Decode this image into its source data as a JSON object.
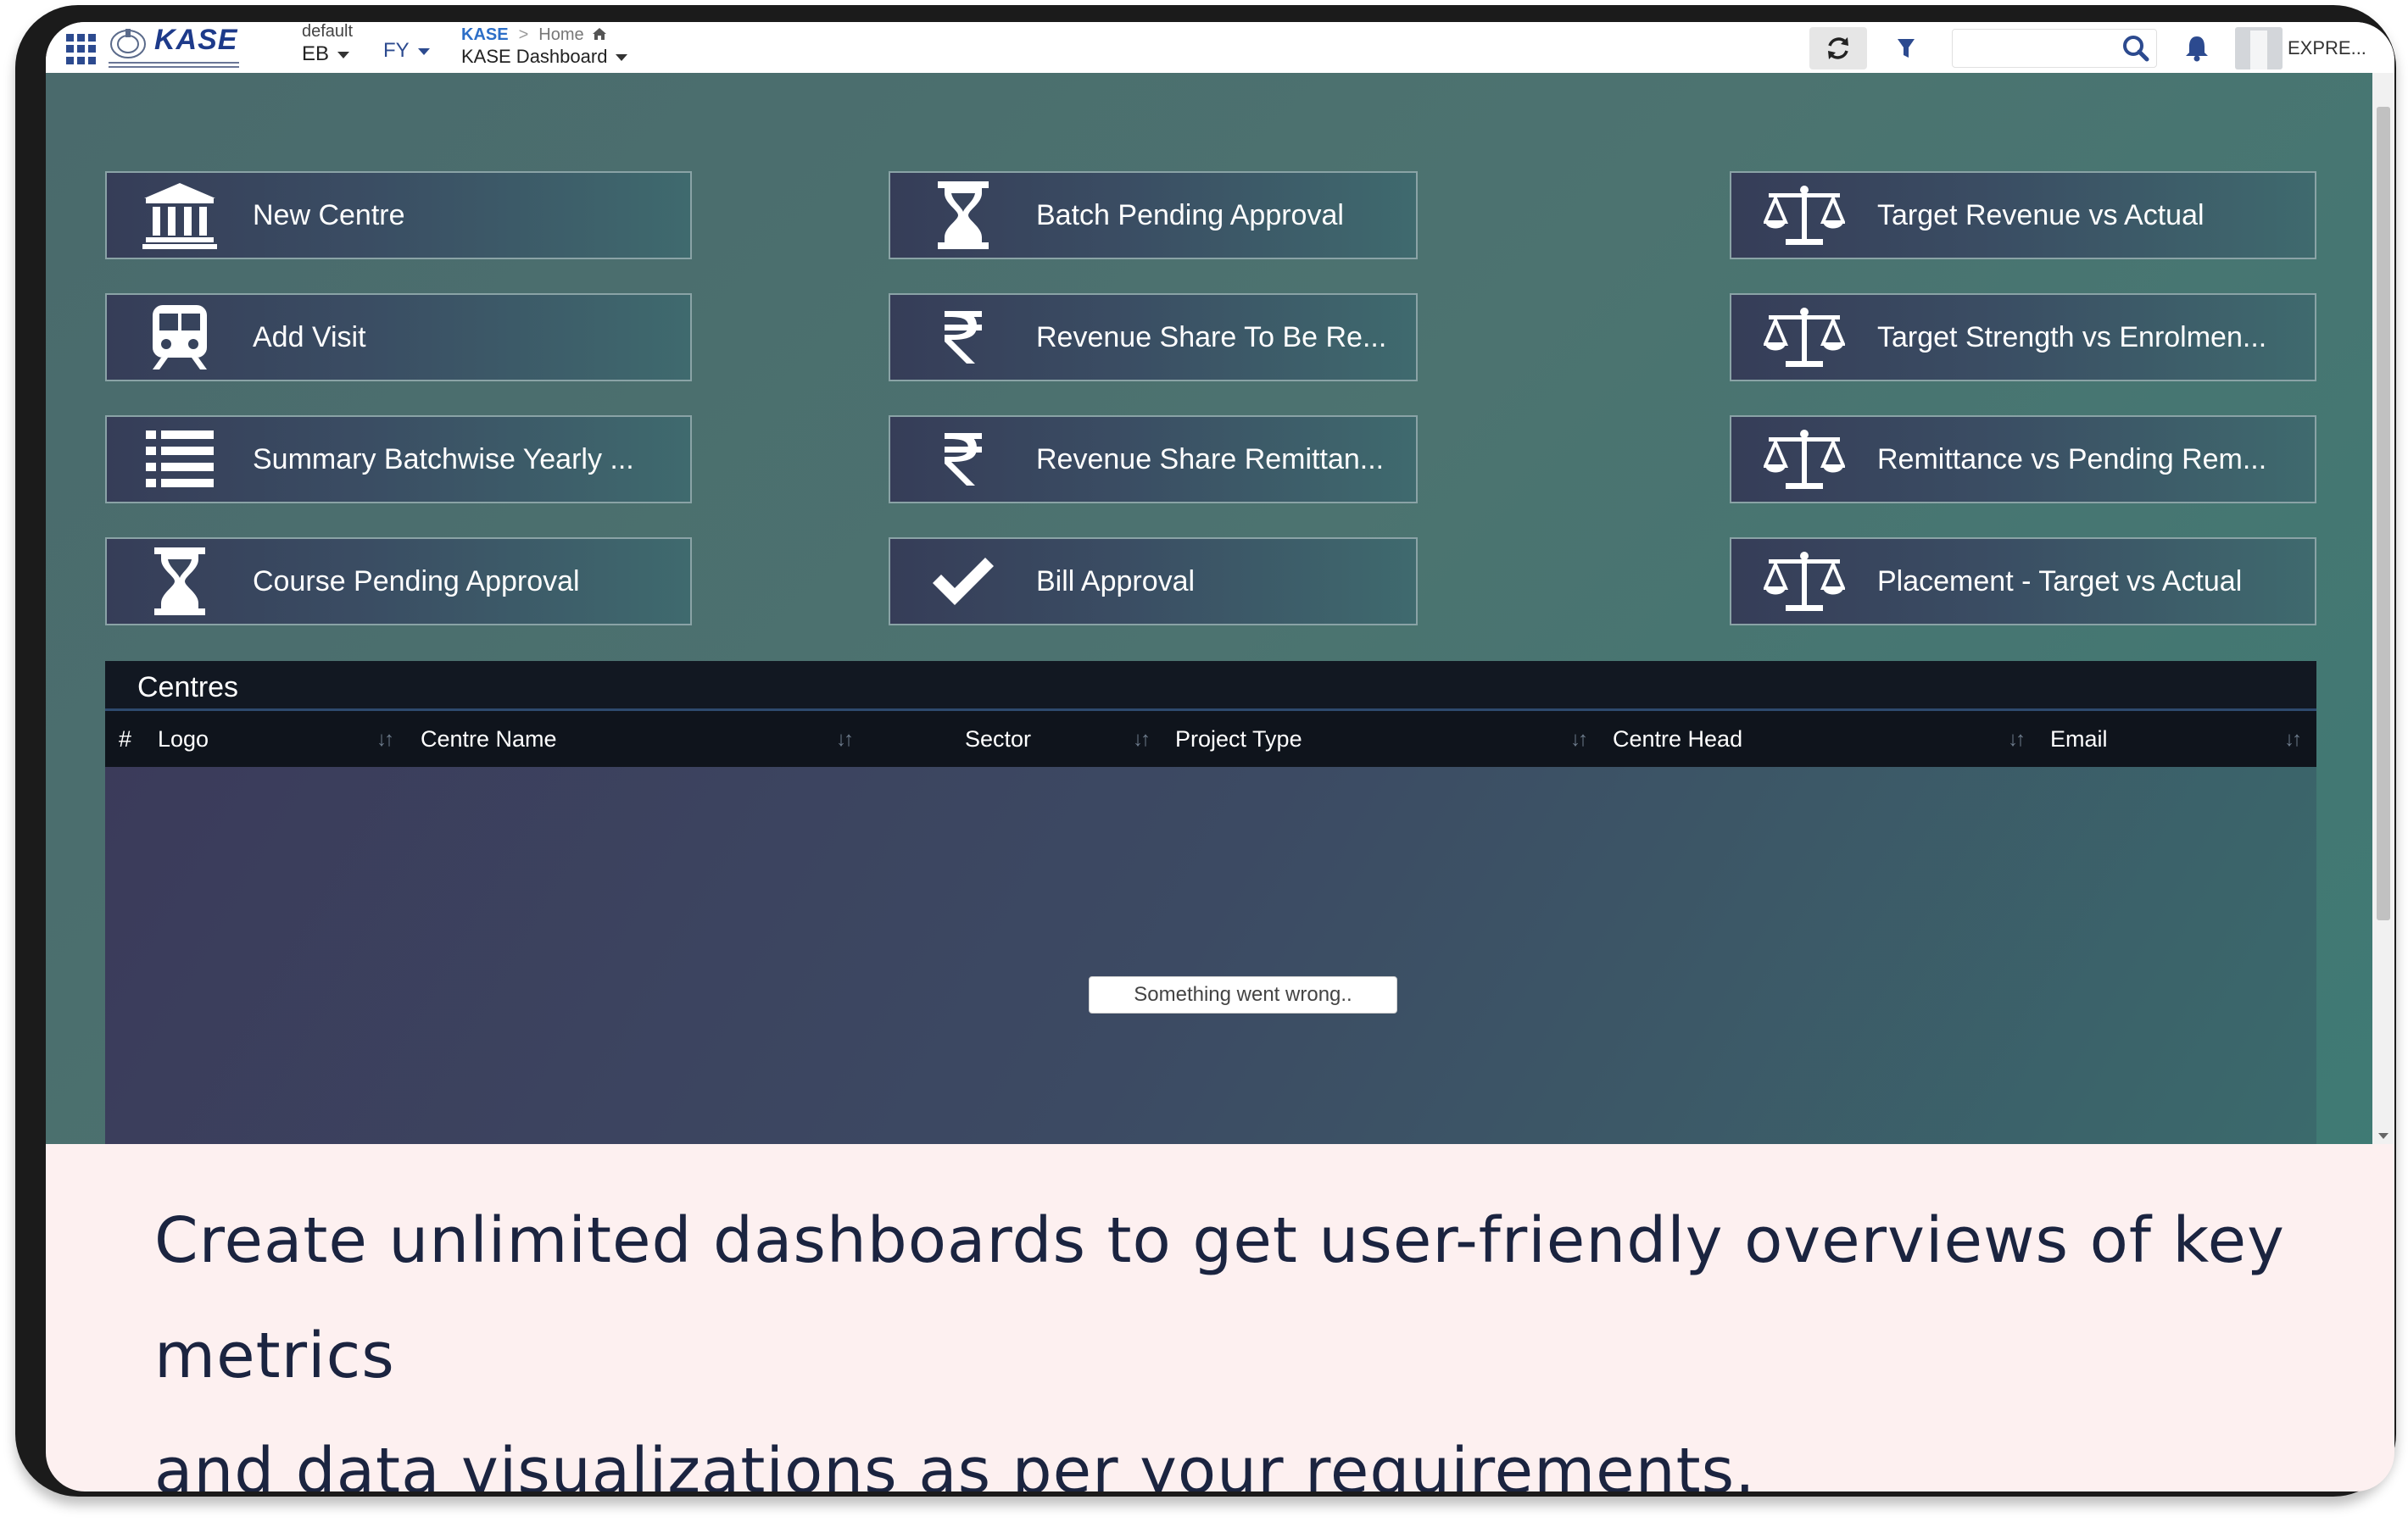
{
  "topbar": {
    "logo_text": "KASE",
    "org_label": "default",
    "org_value": "EB",
    "fy_label": "FY",
    "breadcrumb_root": "KASE",
    "breadcrumb_current": "Home",
    "dashboard_title": "KASE Dashboard",
    "search_placeholder": "",
    "user_name": "EXPRE..."
  },
  "tiles": [
    {
      "label": "New Centre",
      "icon": "bank-icon"
    },
    {
      "label": "Add Visit",
      "icon": "train-icon"
    },
    {
      "label": "Summary Batchwise Yearly ...",
      "icon": "list-icon"
    },
    {
      "label": "Course Pending Approval",
      "icon": "hourglass-icon"
    },
    {
      "label": "Batch Pending Approval",
      "icon": "hourglass-icon"
    },
    {
      "label": "Revenue Share To Be Re...",
      "icon": "rupee-icon"
    },
    {
      "label": "Revenue Share Remittan...",
      "icon": "rupee-icon"
    },
    {
      "label": "Bill Approval",
      "icon": "check-icon"
    },
    {
      "label": "Target Revenue vs Actual",
      "icon": "scale-icon"
    },
    {
      "label": "Target Strength vs Enrolmen...",
      "icon": "scale-icon"
    },
    {
      "label": "Remittance vs Pending Rem...",
      "icon": "scale-icon"
    },
    {
      "label": "Placement - Target vs Actual",
      "icon": "scale-icon"
    }
  ],
  "centres_table": {
    "title": "Centres",
    "columns": [
      "#",
      "Logo",
      "Centre Name",
      "Sector",
      "Project Type",
      "Centre Head",
      "Email"
    ],
    "error": "Something went wrong.."
  },
  "caption": {
    "line1": "Create unlimited dashboards to get user-friendly overviews of key metrics",
    "line2": "and data visualizations as per your requirements."
  },
  "colors": {
    "accent": "#2c4a8f",
    "dashboard_bg": "#4c7370",
    "tile_bg": "#363d58",
    "caption_bg": "#fdf0f0",
    "caption_text": "#1b2440"
  }
}
